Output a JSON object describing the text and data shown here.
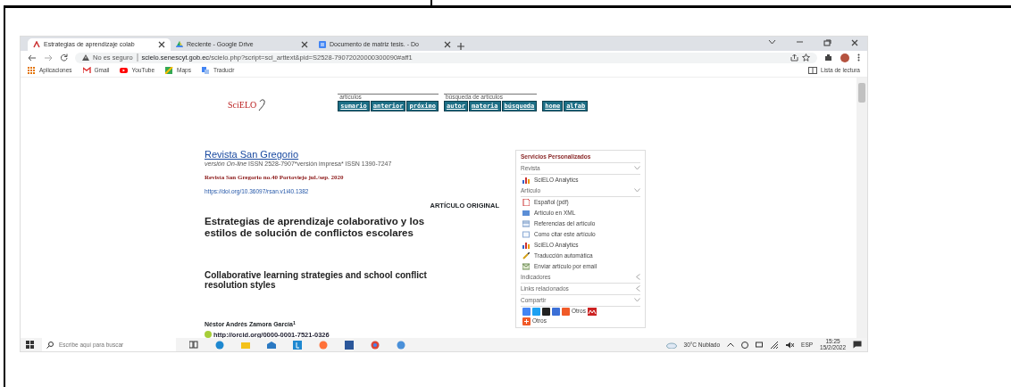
{
  "tabs": [
    {
      "title": "Estrategias de aprendizaje colab",
      "selected": true
    },
    {
      "title": "Reciente - Google Drive",
      "selected": false
    },
    {
      "title": "Documento de matriz tesis. - Do",
      "selected": false
    }
  ],
  "address_bar": {
    "security": "No es seguro",
    "host": "scielo.senescyt.gob.ec",
    "path": "/scielo.php?script=sci_arttext&pid=S2528-79072020000300090#aff1"
  },
  "bookmarks": [
    "Aplicaciones",
    "Gmail",
    "YouTube",
    "Maps",
    "Traducir"
  ],
  "reading_list": "Lista de lectura",
  "page": {
    "logo": "SciELO",
    "nav_groups": [
      {
        "label": "artículos",
        "buttons": [
          "sumario",
          "anterior",
          "próximo"
        ]
      },
      {
        "label": "búsqueda de artículos",
        "buttons": [
          "autor",
          "materia",
          "búsqueda"
        ]
      },
      {
        "buttons": [
          "home",
          "alfab"
        ]
      }
    ],
    "journal": "Revista San Gregorio",
    "issn": "*versión On-line* ISSN 2528-7907*versión impresa* ISSN 1390-7247",
    "issue": "Revista San Gregorio  no.40 Portoviejo jul./sep. 2020",
    "doi": "https://doi.org/10.36097/rsan.v1i40.1382",
    "article_type": "ARTÍCULO ORIGINAL",
    "title_es": "Estrategias de aprendizaje colaborativo y los estilos de solución de conflictos escolares",
    "title_en": "Collaborative learning strategies and school conflict resolution styles",
    "author": "Néstor Andrés Zamora García$^{1}$",
    "orcid": "http://orcid.org/0000-0001-7521-0326"
  },
  "sidebar": {
    "title": "Servicios Personalizados",
    "sections": [
      {
        "label": "Revista",
        "kind": "links",
        "expanded": true,
        "items": [
          "SciELO Analytics"
        ]
      },
      {
        "label": "Artículo",
        "kind": "links",
        "expanded": true,
        "items": [
          "Español (pdf)",
          "Artículo en XML",
          "Referencias del artículo",
          "Como citar este artículo",
          "SciELO Analytics",
          "Traducción automática",
          "Enviar artículo por email"
        ]
      },
      {
        "label": "Indicadores",
        "kind": "links",
        "expanded": false
      },
      {
        "label": "Links relacionados",
        "kind": "links",
        "expanded": false
      },
      {
        "label": "Compartir",
        "kind": "share",
        "expanded": true,
        "items": [
          "Otros",
          "Otros"
        ]
      }
    ]
  },
  "taskbar": {
    "search_placeholder": "Escribe aquí para buscar",
    "weather": "30°C  Nublado",
    "language": "ESP",
    "time": "15:25",
    "date": "15/2/2022"
  }
}
